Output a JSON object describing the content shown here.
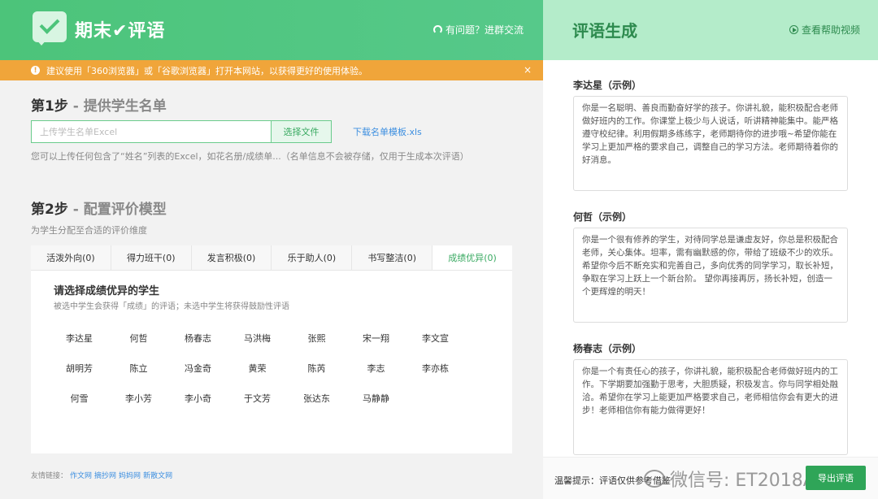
{
  "header": {
    "brand": "期末✔评语",
    "help_link": "有问题？进群交流"
  },
  "notice": {
    "text": "建议使用「360浏览器」或「谷歌浏览器」打开本网站，以获得更好的使用体验。",
    "close": "×"
  },
  "step1": {
    "title": "第1步",
    "subtitle": " - 提供学生名单",
    "upload_placeholder": "上传学生名单Excel",
    "choose_file": "选择文件",
    "template_link": "下载名单模板.xls",
    "hint": "您可以上传任何包含了“姓名”列表的Excel，如花名册/成绩单...（名单信息不会被存储，仅用于生成本次评语）"
  },
  "step2": {
    "title": "第2步",
    "subtitle": " - 配置评价模型",
    "hint": "为学生分配至合适的评价维度",
    "tabs": [
      "活泼外向(0)",
      "得力班干(0)",
      "发言积极(0)",
      "乐于助人(0)",
      "书写整洁(0)",
      "成绩优异(0)"
    ],
    "card_title": "请选择成绩优异的学生",
    "card_desc": "被选中学生会获得「成绩」的评语；未选中学生将获得鼓励性评语",
    "students": [
      "李达星",
      "何哲",
      "杨春志",
      "马洪梅",
      "张熙",
      "宋一翔",
      "李文宣",
      "胡明芳",
      "陈立",
      "冯金奇",
      "黄荣",
      "陈芮",
      "李志",
      "李亦栋",
      "何雪",
      "李小芳",
      "李小奇",
      "于文芳",
      "张达东",
      "马静静"
    ]
  },
  "friend_links": {
    "label": "友情链接：",
    "links": [
      "作文网",
      "摘抄网",
      "妈妈网",
      "新散文网"
    ]
  },
  "right": {
    "title": "评语生成",
    "video_link": "查看帮助视频",
    "comments": [
      {
        "name": "李达星（示例）",
        "text": "你是一名聪明、善良而勤奋好学的孩子。你讲礼貌，能积极配合老师做好班内的工作。你课堂上极少与人说话，听讲精神能集中。能严格遵守校纪律。利用假期多练练字，老师期待你的进步哦~希望你能在学习上更加严格的要求自己，调整自己的学习方法。老师期待着你的好消息。"
      },
      {
        "name": "何哲（示例）",
        "text": "你是一个很有修养的学生，对待同学总是谦虚友好，你总是积极配合老师，关心集体。坦率，需有幽默感的你，带给了班级不少的欢乐。希望你今后不断充实和完善自己，多向优秀的同学学习，取长补短，争取在学习上跃上一个新台阶。 望你再接再厉，扬长补短，创造一个更辉煌的明天！"
      },
      {
        "name": "杨春志（示例）",
        "text": "你是一个有责任心的孩子，你讲礼貌，能积极配合老师做好班内的工作。下学期要加强勤于思考，大胆质疑，积极发言。你与同学相处融洽。希望你在学习上能更加严格要求自己，老师相信你会有更大的进步！老师相信你有能力做得更好！"
      }
    ],
    "tip": "温馨提示：评语仅供参考借鉴",
    "export": "导出评语",
    "watermark": "微信号: ET2018A"
  }
}
